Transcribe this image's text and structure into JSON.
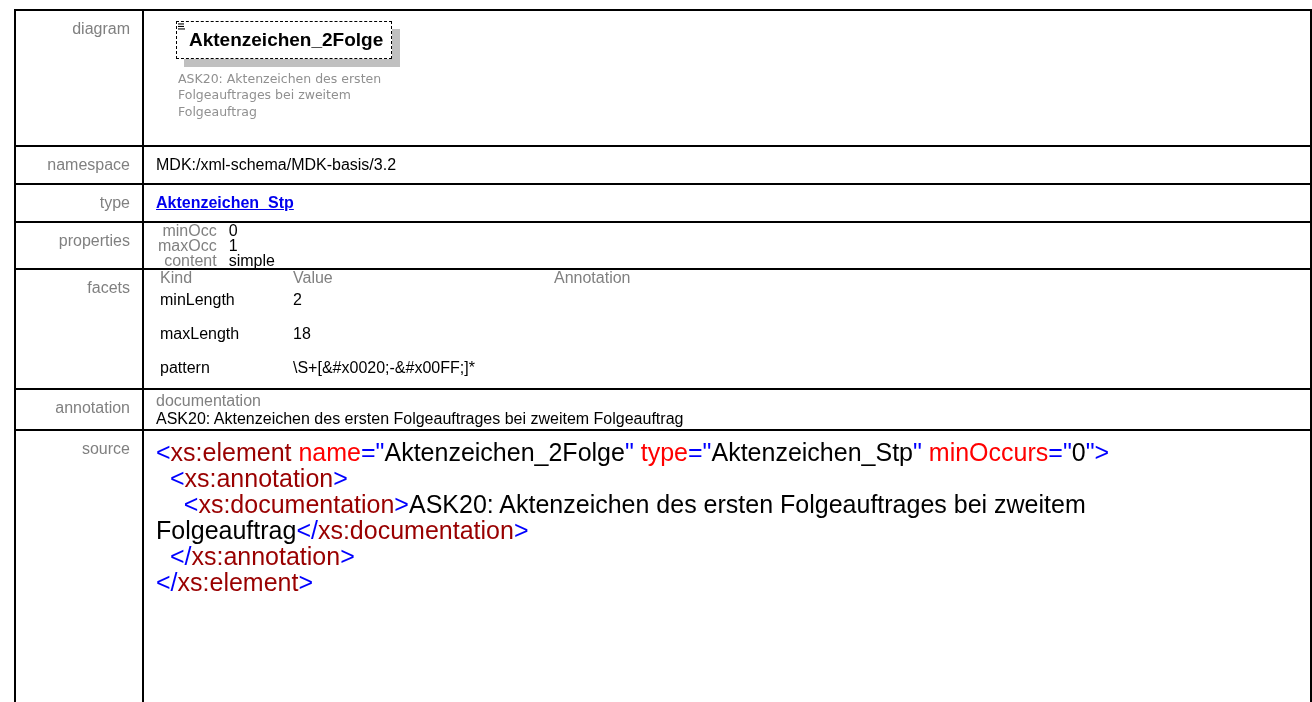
{
  "rows": [
    {
      "kind": "diagram",
      "label": "diagram",
      "element": "Aktenzeichen_2Folge",
      "annotation": "ASK20: Aktenzeichen des ersten Folgeauftrages bei zweitem Folgeauftrag"
    },
    {
      "kind": "text",
      "label": "namespace",
      "value": "MDK:/xml-schema/MDK-basis/3.2"
    },
    {
      "kind": "link",
      "label": "type",
      "value": "Aktenzeichen_Stp"
    },
    {
      "kind": "properties",
      "label": "properties",
      "items": [
        {
          "name": "minOcc",
          "value": "0"
        },
        {
          "name": "maxOcc",
          "value": "1"
        },
        {
          "name": "content",
          "value": "simple"
        }
      ]
    },
    {
      "kind": "facets",
      "label": "facets",
      "columns": [
        "Kind",
        "Value",
        "Annotation"
      ],
      "items": [
        {
          "name": "minLength",
          "value": "2"
        },
        {
          "name": "maxLength",
          "value": "18"
        },
        {
          "name": "pattern",
          "value": "\\S+[&#x0020;-&#x00FF;]*"
        }
      ]
    },
    {
      "kind": "annotation",
      "label": "annotation",
      "heading": "documentation",
      "text": "ASK20: Aktenzeichen des ersten Folgeauftrages bei zweitem Folgeauftrag"
    },
    {
      "kind": "source",
      "label": "source",
      "lines": [
        [
          {
            "kind": "punct",
            "s": "<"
          },
          {
            "kind": "elem",
            "s": "xs:element"
          },
          {
            "kind": "attr",
            "s": " name"
          },
          {
            "kind": "punct",
            "s": "=\""
          },
          {
            "kind": "value",
            "s": "Aktenzeichen_2Folge"
          },
          {
            "kind": "punct",
            "s": "\""
          },
          {
            "kind": "attr",
            "s": " type"
          },
          {
            "kind": "punct",
            "s": "=\""
          },
          {
            "kind": "value",
            "s": "Aktenzeichen_Stp"
          },
          {
            "kind": "punct",
            "s": "\""
          },
          {
            "kind": "attr",
            "s": " minOccurs"
          },
          {
            "kind": "punct",
            "s": "=\""
          },
          {
            "kind": "value",
            "s": "0"
          },
          {
            "kind": "punct",
            "s": "\">"
          }
        ],
        [
          {
            "kind": "punct",
            "s": "  <"
          },
          {
            "kind": "elem",
            "s": "xs:annotation"
          },
          {
            "kind": "punct",
            "s": ">"
          }
        ],
        [
          {
            "kind": "punct",
            "s": "    <"
          },
          {
            "kind": "elem",
            "s": "xs:documentation"
          },
          {
            "kind": "punct",
            "s": ">"
          },
          {
            "kind": "text",
            "s": "ASK20: Aktenzeichen des ersten Folgeauftrages bei zweitem Folgeauftrag"
          },
          {
            "kind": "punct",
            "s": "</"
          },
          {
            "kind": "elem",
            "s": "xs:documentation"
          },
          {
            "kind": "punct",
            "s": ">"
          }
        ],
        [
          {
            "kind": "punct",
            "s": "  </"
          },
          {
            "kind": "elem",
            "s": "xs:annotation"
          },
          {
            "kind": "punct",
            "s": ">"
          }
        ],
        [
          {
            "kind": "punct",
            "s": "</"
          },
          {
            "kind": "elem",
            "s": "xs:element"
          },
          {
            "kind": "punct",
            "s": ">"
          }
        ]
      ]
    }
  ]
}
